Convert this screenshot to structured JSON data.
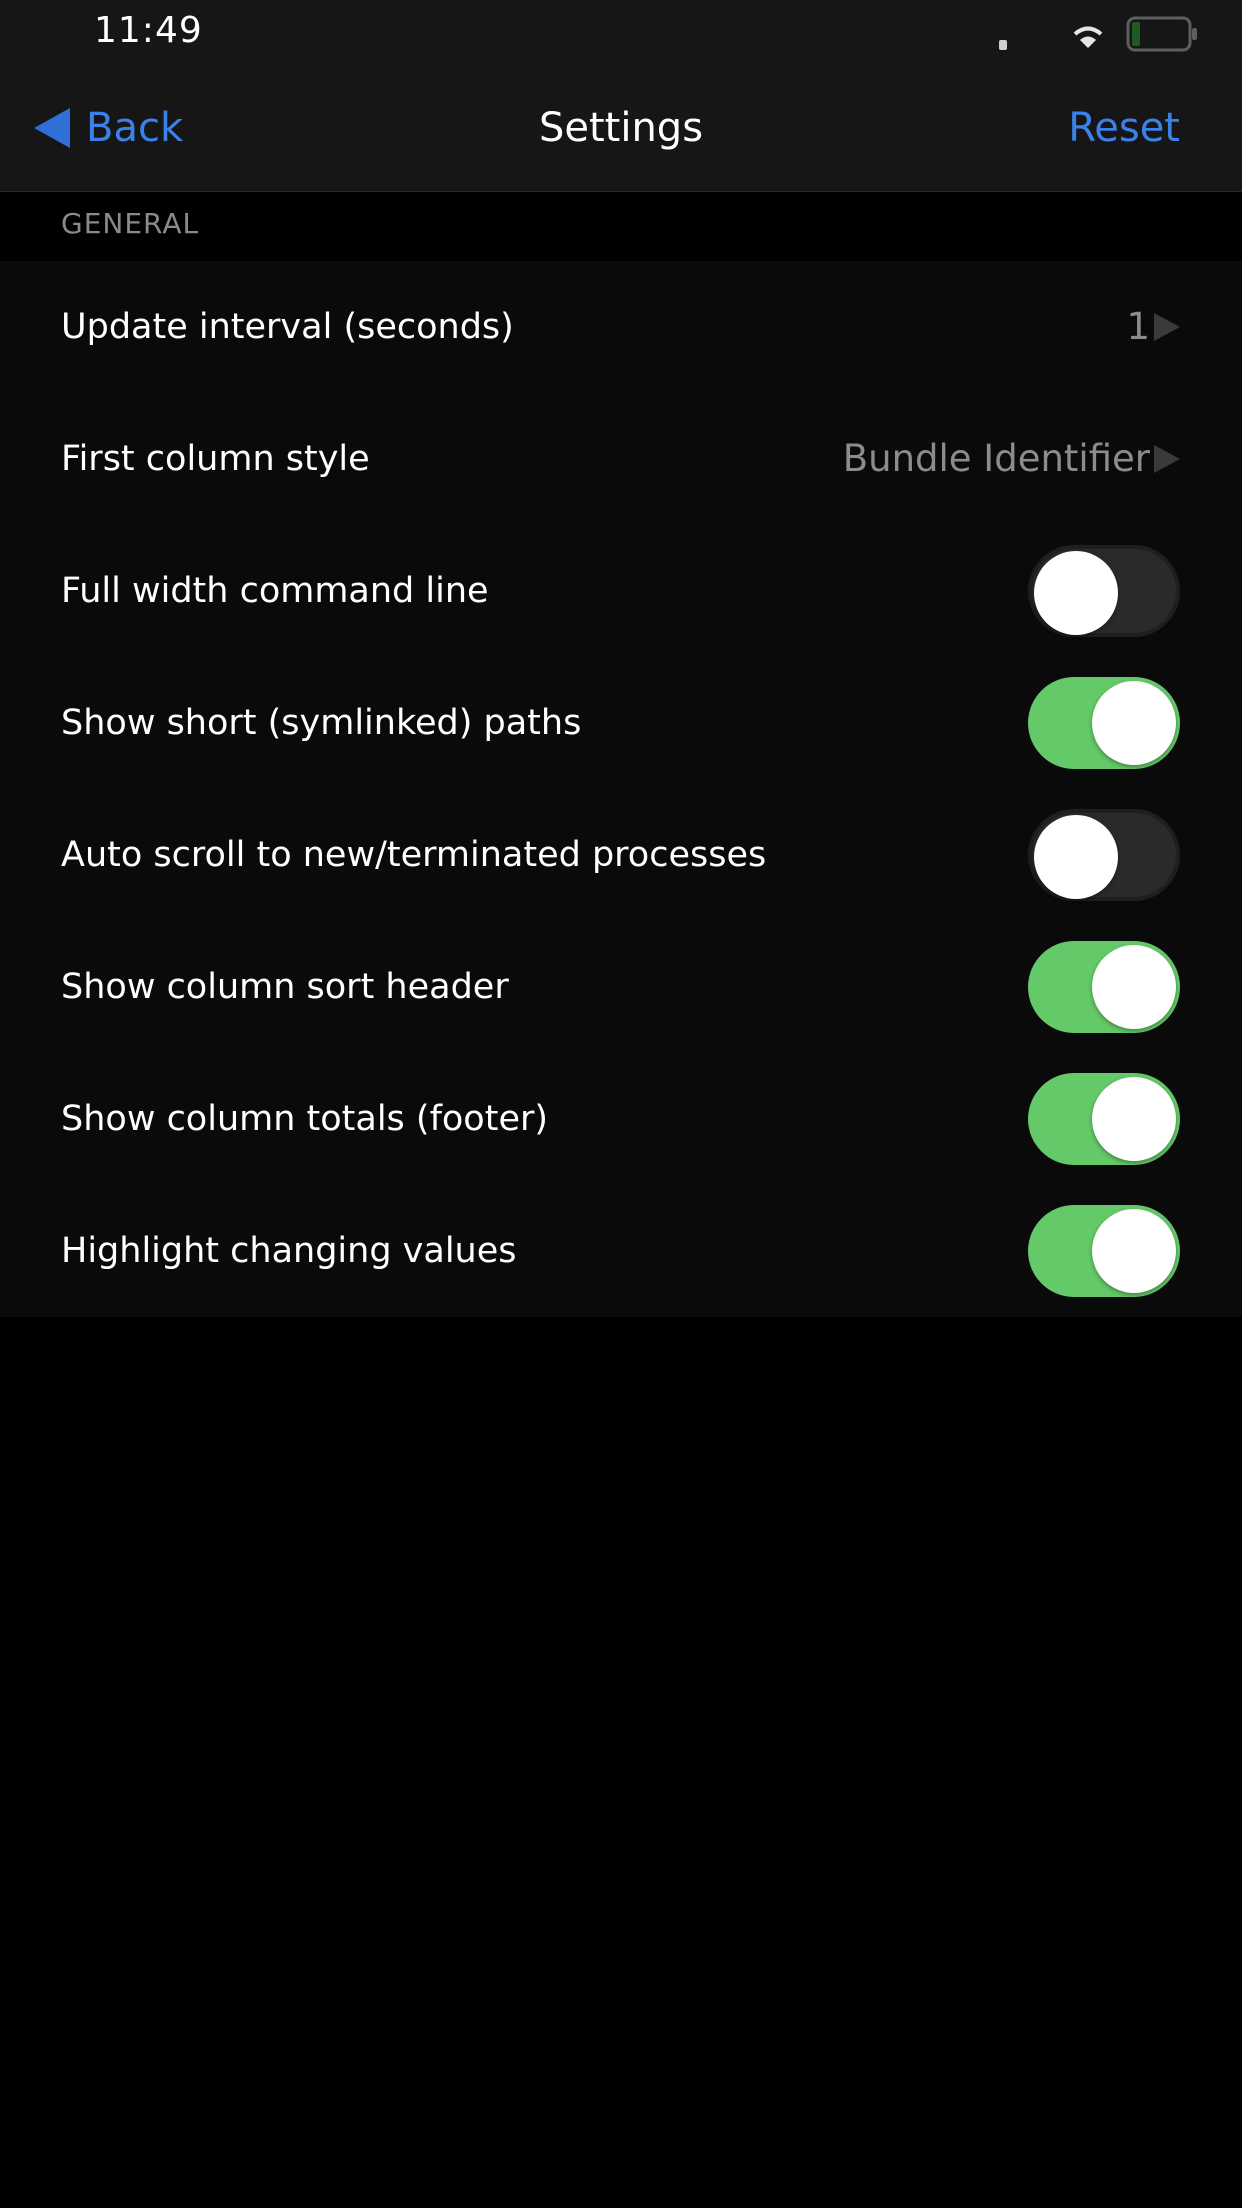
{
  "status_bar": {
    "time": "11:49"
  },
  "nav": {
    "back_label": "Back",
    "title": "Settings",
    "reset_label": "Reset"
  },
  "section": {
    "header": "GENERAL"
  },
  "colors": {
    "accent": "#3a82ea",
    "toggle_on": "#64c968",
    "toggle_off": "#2a2a2c",
    "background": "#000000"
  },
  "rows": [
    {
      "label": "Update interval (seconds)",
      "type": "disclosure",
      "value": "1"
    },
    {
      "label": "First column style",
      "type": "disclosure",
      "value": "Bundle Identifier"
    },
    {
      "label": "Full width command line",
      "type": "toggle",
      "on": false
    },
    {
      "label": "Show short (symlinked) paths",
      "type": "toggle",
      "on": true
    },
    {
      "label": "Auto scroll to new/terminated processes",
      "type": "toggle",
      "on": false
    },
    {
      "label": "Show column sort header",
      "type": "toggle",
      "on": true
    },
    {
      "label": "Show column totals (footer)",
      "type": "toggle",
      "on": true
    },
    {
      "label": "Highlight changing values",
      "type": "toggle",
      "on": true
    }
  ]
}
